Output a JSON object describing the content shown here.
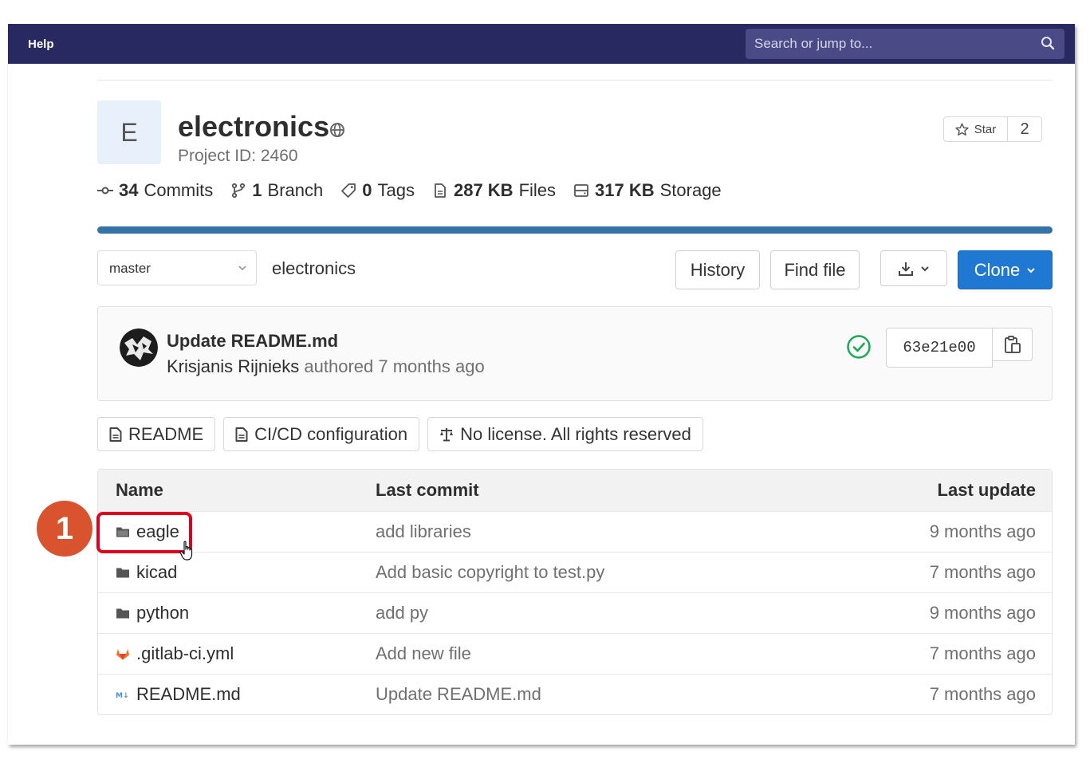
{
  "navbar": {
    "help_label": "Help",
    "search_placeholder": "Search or jump to..."
  },
  "project": {
    "avatar_letter": "E",
    "name": "electronics",
    "project_id": "Project ID: 2460",
    "star_label": "Star",
    "star_count": "2"
  },
  "stats": [
    {
      "value": "34",
      "label": "Commits"
    },
    {
      "value": "1",
      "label": "Branch"
    },
    {
      "value": "0",
      "label": "Tags"
    },
    {
      "value": "287 KB",
      "label": "Files"
    },
    {
      "value": "317 KB",
      "label": "Storage"
    }
  ],
  "toolbar": {
    "branch": "master",
    "breadcrumb": "electronics",
    "history_label": "History",
    "find_file_label": "Find file",
    "clone_label": "Clone"
  },
  "last_commit": {
    "title": "Update README.md",
    "author": "Krisjanis Rijnieks",
    "meta": "authored 7 months ago",
    "sha": "63e21e00",
    "status": "passed"
  },
  "quick_links": [
    {
      "label": "README",
      "icon": "doc-icon"
    },
    {
      "label": "CI/CD configuration",
      "icon": "doc-icon"
    },
    {
      "label": "No license. All rights reserved",
      "icon": "scale-icon"
    }
  ],
  "file_table": {
    "headers": {
      "name": "Name",
      "last_commit": "Last commit",
      "last_update": "Last update"
    },
    "rows": [
      {
        "name": "eagle",
        "type": "folder",
        "commit": "add libraries",
        "updated": "9 months ago"
      },
      {
        "name": "kicad",
        "type": "folder",
        "commit": "Add basic copyright to test.py",
        "updated": "7 months ago"
      },
      {
        "name": "python",
        "type": "folder",
        "commit": "add py",
        "updated": "9 months ago"
      },
      {
        "name": ".gitlab-ci.yml",
        "type": "gitlab",
        "commit": "Add new file",
        "updated": "7 months ago"
      },
      {
        "name": "README.md",
        "type": "markdown",
        "commit": "Update README.md",
        "updated": "7 months ago"
      }
    ]
  },
  "annotation": {
    "step": "1"
  },
  "colors": {
    "navbar": "#292961",
    "accent": "#1f78d1",
    "language_bar": "#3572a5",
    "highlight": "#e3001b",
    "badge": "#d9532f",
    "success": "#1aaa55"
  }
}
